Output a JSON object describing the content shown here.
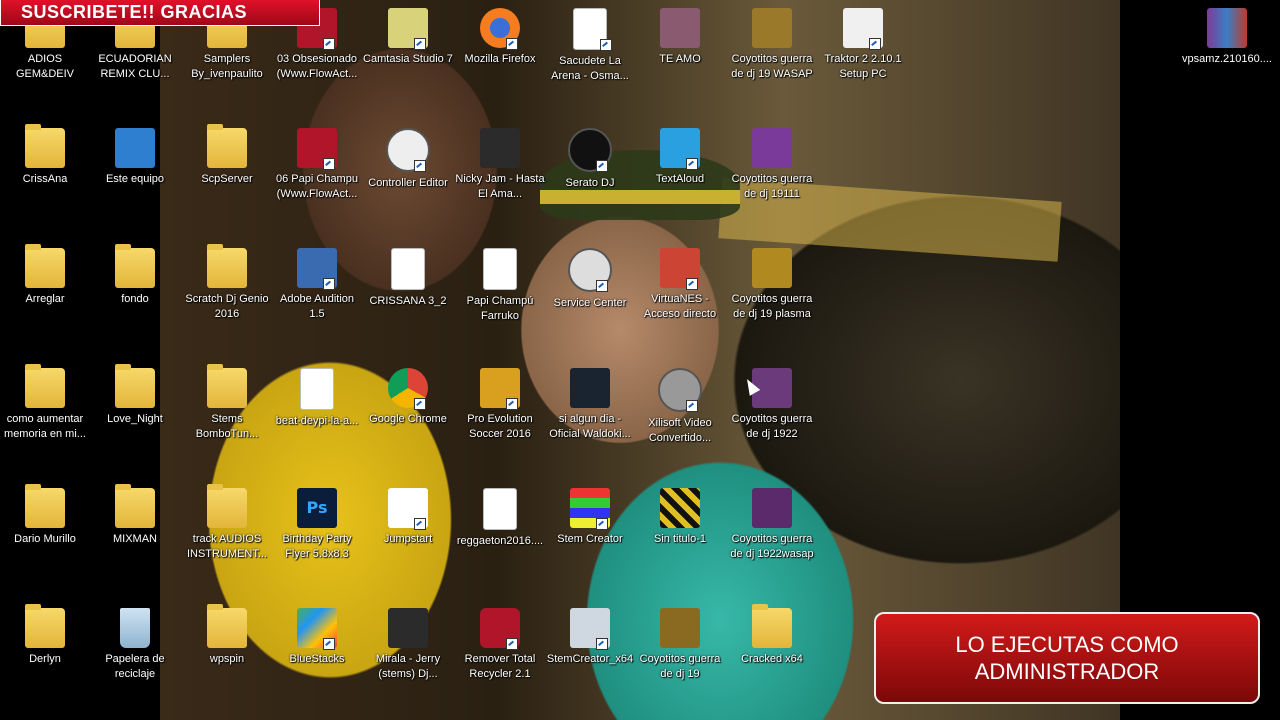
{
  "overlay": {
    "subscribe": "SUSCRIBETE!! GRACIAS",
    "admin_caption": "LO EJECUTAS COMO ADMINISTRADOR"
  },
  "desktop_icons": [
    {
      "label": "ADIOS GEM&DEIV",
      "icon": "folder-icon"
    },
    {
      "label": "ECUADORIAN REMIX CLU...",
      "icon": "folder-icon"
    },
    {
      "label": "Samplers By_ivenpaulito",
      "icon": "folder-icon"
    },
    {
      "label": "03 Obsesionado (Www.FlowAct...",
      "icon": "media-icon"
    },
    {
      "label": "Camtasia Studio 7",
      "icon": "camtasia-icon"
    },
    {
      "label": "Mozilla Firefox",
      "icon": "firefox-icon"
    },
    {
      "label": "Sacudete La Arena - Osma...",
      "icon": "mp3-icon"
    },
    {
      "label": "TE AMO",
      "icon": "photo-icon"
    },
    {
      "label": "Coyotitos guerra de dj 19 WASAP",
      "icon": "image-icon"
    },
    {
      "label": "Traktor 2 2.10.1 Setup PC",
      "icon": "installer-icon"
    },
    {
      "label": "vpsamz.210160....",
      "icon": "winrar-icon"
    },
    {
      "label": "CrissAna",
      "icon": "folder-icon"
    },
    {
      "label": "Este equipo",
      "icon": "computer-icon"
    },
    {
      "label": "ScpServer",
      "icon": "folder-icon"
    },
    {
      "label": "06 Papi Champu (Www.FlowAct...",
      "icon": "media-icon"
    },
    {
      "label": "Controller Editor",
      "icon": "controller-icon"
    },
    {
      "label": "Nicky Jam - Hasta El Ama...",
      "icon": "video-icon"
    },
    {
      "label": "Serato DJ",
      "icon": "serato-icon"
    },
    {
      "label": "TextAloud",
      "icon": "textaloud-icon"
    },
    {
      "label": "Coyotitos guerra de dj 19111",
      "icon": "image-icon"
    },
    {
      "label": "Arreglar",
      "icon": "folder-icon"
    },
    {
      "label": "fondo",
      "icon": "folder-icon"
    },
    {
      "label": "Scratch Dj Genio 2016",
      "icon": "folder-icon"
    },
    {
      "label": "Adobe Audition 1.5",
      "icon": "audition-icon"
    },
    {
      "label": "CRISSANA 3_2",
      "icon": "mp3-icon"
    },
    {
      "label": "Papi Champú Farruko",
      "icon": "mp3-icon"
    },
    {
      "label": "Service Center",
      "icon": "service-icon"
    },
    {
      "label": "VirtuaNES - Acceso directo",
      "icon": "nes-icon"
    },
    {
      "label": "Coyotitos guerra de dj 19 plasma",
      "icon": "image-icon"
    },
    {
      "label": "como aumentar memoria en mi...",
      "icon": "folder-icon"
    },
    {
      "label": "Love_Night",
      "icon": "folder-icon"
    },
    {
      "label": "Stems BomboTun...",
      "icon": "folder-icon"
    },
    {
      "label": "beat-deypi-la-a...",
      "icon": "mp3-icon"
    },
    {
      "label": "Google Chrome",
      "icon": "chrome-icon"
    },
    {
      "label": "Pro Evolution Soccer 2016",
      "icon": "pes-icon"
    },
    {
      "label": "si algun dia - Oficial Waldoki...",
      "icon": "video-icon"
    },
    {
      "label": "Xilisoft Video Convertido...",
      "icon": "xilisoft-icon"
    },
    {
      "label": "Coyotitos guerra de dj 1922",
      "icon": "image-icon"
    },
    {
      "label": "Dario Murillo",
      "icon": "folder-icon"
    },
    {
      "label": "MIXMAN",
      "icon": "folder-icon"
    },
    {
      "label": "track AUDIOS INSTRUMENT...",
      "icon": "folder-icon"
    },
    {
      "label": "Birthday Party Flyer 5.8x8.3",
      "icon": "photoshop-icon"
    },
    {
      "label": "Jumpstart",
      "icon": "jumpstart-icon"
    },
    {
      "label": "reggaeton2016....",
      "icon": "wav-icon"
    },
    {
      "label": "Stem Creator",
      "icon": "stem-creator-icon"
    },
    {
      "label": "Sin titulo-1",
      "icon": "psd-icon"
    },
    {
      "label": "Coyotitos guerra de dj 1922wasap",
      "icon": "image-icon"
    },
    {
      "label": "Derlyn",
      "icon": "folder-icon"
    },
    {
      "label": "Papelera de reciclaje",
      "icon": "recycle-bin-icon"
    },
    {
      "label": "wpspin",
      "icon": "folder-icon"
    },
    {
      "label": "BlueStacks",
      "icon": "bluestacks-icon"
    },
    {
      "label": "Mirala - Jerry (stems) Dj...",
      "icon": "video-icon"
    },
    {
      "label": "Remover Total Recycler 2.1",
      "icon": "usb-icon"
    },
    {
      "label": "StemCreator_x64",
      "icon": "installer-icon"
    },
    {
      "label": "Coyotitos guerra de dj 19",
      "icon": "image-icon"
    },
    {
      "label": "Cracked x64",
      "icon": "folder-icon"
    }
  ]
}
